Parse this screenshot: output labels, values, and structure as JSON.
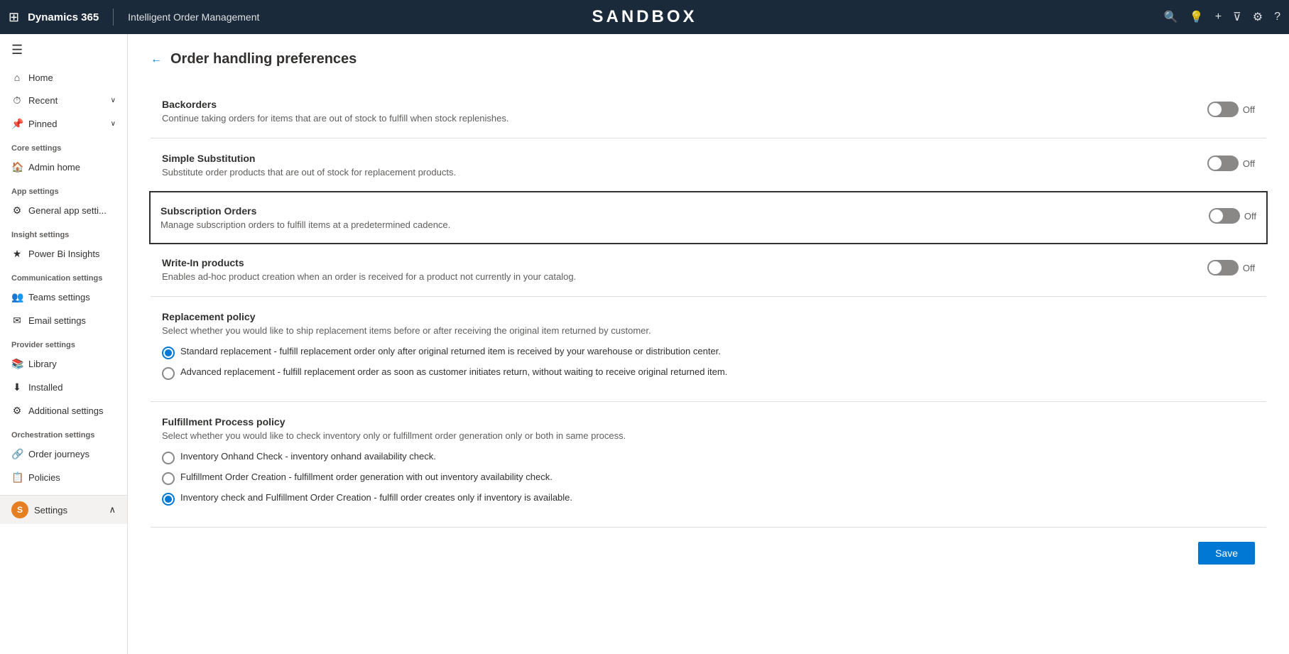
{
  "app": {
    "name": "Dynamics 365",
    "module": "Intelligent Order Management",
    "sandbox_label": "SANDBOX"
  },
  "topbar_icons": {
    "waffle": "⊞",
    "search": "🔍",
    "lightbulb": "💡",
    "add": "+",
    "filter": "⊽",
    "settings": "⚙",
    "help": "?"
  },
  "sidebar": {
    "hamburger": "☰",
    "nav_items": [
      {
        "label": "Home",
        "icon": "⌂"
      },
      {
        "label": "Recent",
        "icon": "⏱",
        "chevron": true
      },
      {
        "label": "Pinned",
        "icon": "📌",
        "chevron": true
      }
    ],
    "core_settings_label": "Core settings",
    "core_items": [
      {
        "label": "Admin home",
        "icon": "🏠"
      }
    ],
    "app_settings_label": "App settings",
    "app_items": [
      {
        "label": "General app setti...",
        "icon": "⚙"
      }
    ],
    "insight_settings_label": "Insight settings",
    "insight_items": [
      {
        "label": "Power Bi Insights",
        "icon": "★"
      }
    ],
    "communication_settings_label": "Communication settings",
    "communication_items": [
      {
        "label": "Teams settings",
        "icon": "👥"
      },
      {
        "label": "Email settings",
        "icon": "✉"
      }
    ],
    "provider_settings_label": "Provider settings",
    "provider_items": [
      {
        "label": "Library",
        "icon": "📚"
      },
      {
        "label": "Installed",
        "icon": "⬇"
      },
      {
        "label": "Additional settings",
        "icon": "⚙"
      }
    ],
    "orchestration_settings_label": "Orchestration settings",
    "orchestration_items": [
      {
        "label": "Order journeys",
        "icon": "🔗"
      },
      {
        "label": "Policies",
        "icon": "📋"
      }
    ],
    "footer": {
      "label": "Settings",
      "avatar_letter": "S",
      "chevron": "∧"
    }
  },
  "page": {
    "back_arrow": "←",
    "title": "Order handling preferences"
  },
  "settings": [
    {
      "id": "backorders",
      "title": "Backorders",
      "description": "Continue taking orders for items that are out of stock to fulfill when stock replenishes.",
      "toggle_state": "Off",
      "highlighted": false
    },
    {
      "id": "simple-substitution",
      "title": "Simple Substitution",
      "description": "Substitute order products that are out of stock for replacement products.",
      "toggle_state": "Off",
      "highlighted": false
    },
    {
      "id": "subscription-orders",
      "title": "Subscription Orders",
      "description": "Manage subscription orders to fulfill items at a predetermined cadence.",
      "toggle_state": "Off",
      "highlighted": true
    },
    {
      "id": "write-in-products",
      "title": "Write-In products",
      "description": "Enables ad-hoc product creation when an order is received for a product not currently in your catalog.",
      "toggle_state": "Off",
      "highlighted": false
    }
  ],
  "replacement_policy": {
    "title": "Replacement policy",
    "description": "Select whether you would like to ship replacement items before or after receiving the original item returned by customer.",
    "options": [
      {
        "id": "standard",
        "label": "Standard replacement - fulfill replacement order only after original returned item is received by your warehouse or distribution center.",
        "selected": true
      },
      {
        "id": "advanced",
        "label": "Advanced replacement - fulfill replacement order as soon as customer initiates return, without waiting to receive original returned item.",
        "selected": false
      }
    ]
  },
  "fulfillment_policy": {
    "title": "Fulfillment Process policy",
    "description": "Select whether you would like to check inventory only or fulfillment order generation only or both in same process.",
    "options": [
      {
        "id": "inventory-onhand",
        "label": "Inventory Onhand Check - inventory onhand availability check.",
        "selected": false
      },
      {
        "id": "fulfillment-order-creation",
        "label": "Fulfillment Order Creation - fulfillment order generation with out inventory availability check.",
        "selected": false
      },
      {
        "id": "inventory-check-and-fulfillment",
        "label": "Inventory check and Fulfillment Order Creation - fulfill order creates only if inventory is available.",
        "selected": true
      }
    ]
  },
  "buttons": {
    "save_label": "Save"
  }
}
